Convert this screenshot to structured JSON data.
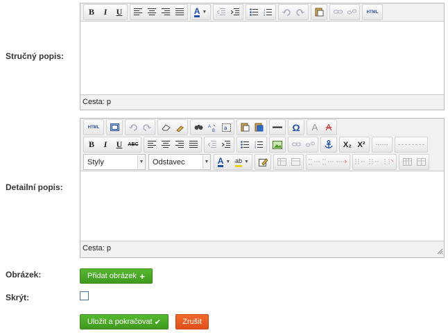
{
  "form": {
    "short_desc_label": "Stručný popis:",
    "detail_desc_label": "Detailní popis:",
    "image_label": "Obrázek:",
    "hide_label": "Skrýt:",
    "add_image_button": "Přidat obrázek",
    "add_image_icon": "+",
    "save_button": "Uložit a pokračovat",
    "save_icon": "✔",
    "cancel_button": "Zrušit",
    "hide_checked": false
  },
  "editor1": {
    "status": "Cesta: p"
  },
  "editor2": {
    "status": "Cesta: p",
    "style_value": "Styly",
    "format_value": "Odstavec"
  },
  "icons": {
    "bold": "B",
    "italic": "I",
    "underline": "U",
    "strike": "ABC",
    "html": "HTML",
    "subscript": "X₂",
    "superscript": "X²",
    "omega": "Ω",
    "color_a": "A",
    "find": "🔍"
  },
  "colors": {
    "green": "#4aa826",
    "red": "#e85a20",
    "accent_blue": "#1f4ea8"
  }
}
